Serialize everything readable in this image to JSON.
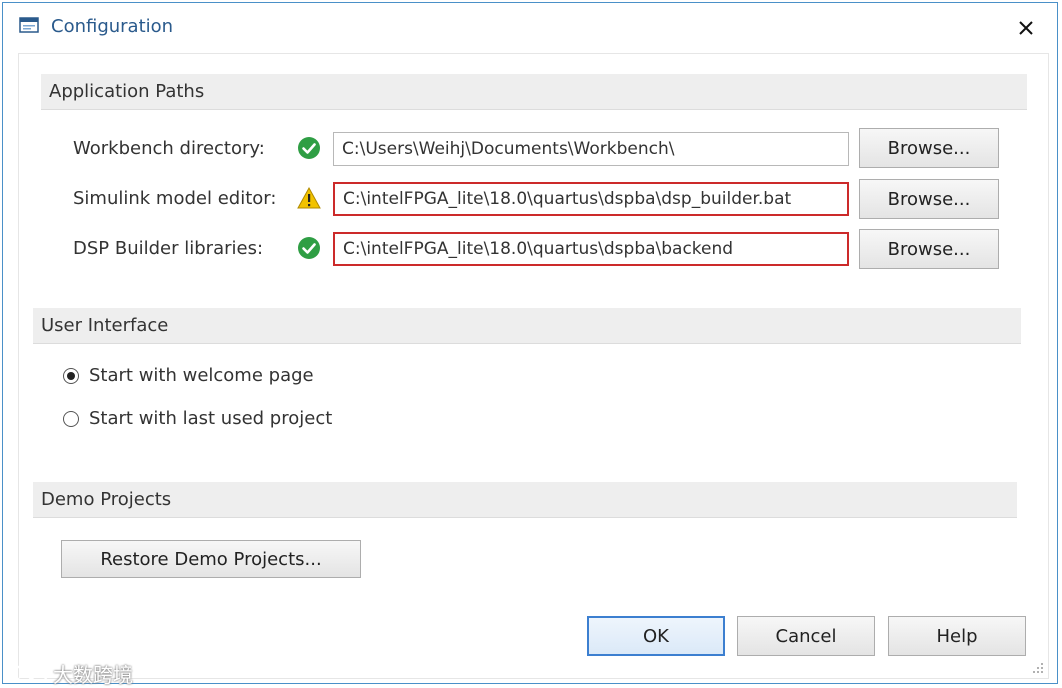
{
  "window": {
    "title": "Configuration",
    "title_icon": "window-icon",
    "close_icon": "close-icon",
    "accent": "#2a5a8c"
  },
  "application_paths": {
    "header": "Application Paths",
    "rows": [
      {
        "label": "Workbench directory:",
        "status": "ok",
        "status_icon": "check-icon",
        "value": "C:\\Users\\Weihj\\Documents\\Workbench\\",
        "browse_label": "Browse..."
      },
      {
        "label": "Simulink model editor:",
        "status": "warning",
        "status_icon": "warning-icon",
        "value": "C:\\intelFPGA_lite\\18.0\\quartus\\dspba\\dsp_builder.bat",
        "browse_label": "Browse..."
      },
      {
        "label": "DSP Builder libraries:",
        "status": "ok",
        "status_icon": "check-icon",
        "value": "C:\\intelFPGA_lite\\18.0\\quartus\\dspba\\backend",
        "browse_label": "Browse..."
      }
    ]
  },
  "user_interface": {
    "header": "User Interface",
    "options": [
      {
        "label": "Start with welcome page",
        "selected": true
      },
      {
        "label": "Start with last used project",
        "selected": false
      }
    ]
  },
  "demo_projects": {
    "header": "Demo Projects",
    "restore_label": "Restore Demo Projects..."
  },
  "footer": {
    "ok_label": "OK",
    "cancel_label": "Cancel",
    "help_label": "Help"
  },
  "watermark": {
    "text": "大数跨境",
    "icon": "chat-bubble-icon"
  },
  "colors": {
    "ok": "#2f9e44",
    "warning": "#f2c200",
    "invalid_border": "#cc2a2a",
    "default_button_border": "#3c7fd0"
  }
}
